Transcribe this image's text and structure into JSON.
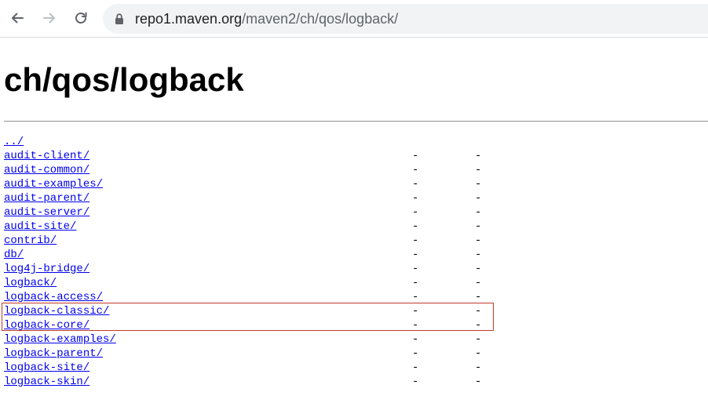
{
  "browser": {
    "back_icon": "arrow-left-icon",
    "forward_icon": "arrow-right-icon",
    "reload_icon": "reload-icon",
    "lock_icon": "lock-icon",
    "url_host": "repo1.maven.org",
    "url_path": "/maven2/ch/qos/logback/"
  },
  "page": {
    "title": "ch/qos/logback",
    "entries": [
      {
        "name": "../",
        "date": "",
        "size": ""
      },
      {
        "name": "audit-client/",
        "date": "-",
        "size": "-"
      },
      {
        "name": "audit-common/",
        "date": "-",
        "size": "-"
      },
      {
        "name": "audit-examples/",
        "date": "-",
        "size": "-"
      },
      {
        "name": "audit-parent/",
        "date": "-",
        "size": "-"
      },
      {
        "name": "audit-server/",
        "date": "-",
        "size": "-"
      },
      {
        "name": "audit-site/",
        "date": "-",
        "size": "-"
      },
      {
        "name": "contrib/",
        "date": "-",
        "size": "-"
      },
      {
        "name": "db/",
        "date": "-",
        "size": "-"
      },
      {
        "name": "log4j-bridge/",
        "date": "-",
        "size": "-"
      },
      {
        "name": "logback/",
        "date": "-",
        "size": "-"
      },
      {
        "name": "logback-access/",
        "date": "-",
        "size": "-"
      },
      {
        "name": "logback-classic/",
        "date": "-",
        "size": "-"
      },
      {
        "name": "logback-core/",
        "date": "-",
        "size": "-"
      },
      {
        "name": "logback-examples/",
        "date": "-",
        "size": "-"
      },
      {
        "name": "logback-parent/",
        "date": "-",
        "size": "-"
      },
      {
        "name": "logback-site/",
        "date": "-",
        "size": "-"
      },
      {
        "name": "logback-skin/",
        "date": "-",
        "size": "-"
      }
    ]
  },
  "colors": {
    "link": "#0000ee",
    "highlight_border": "#c0392b",
    "omnibox_bg": "#f1f3f4"
  }
}
